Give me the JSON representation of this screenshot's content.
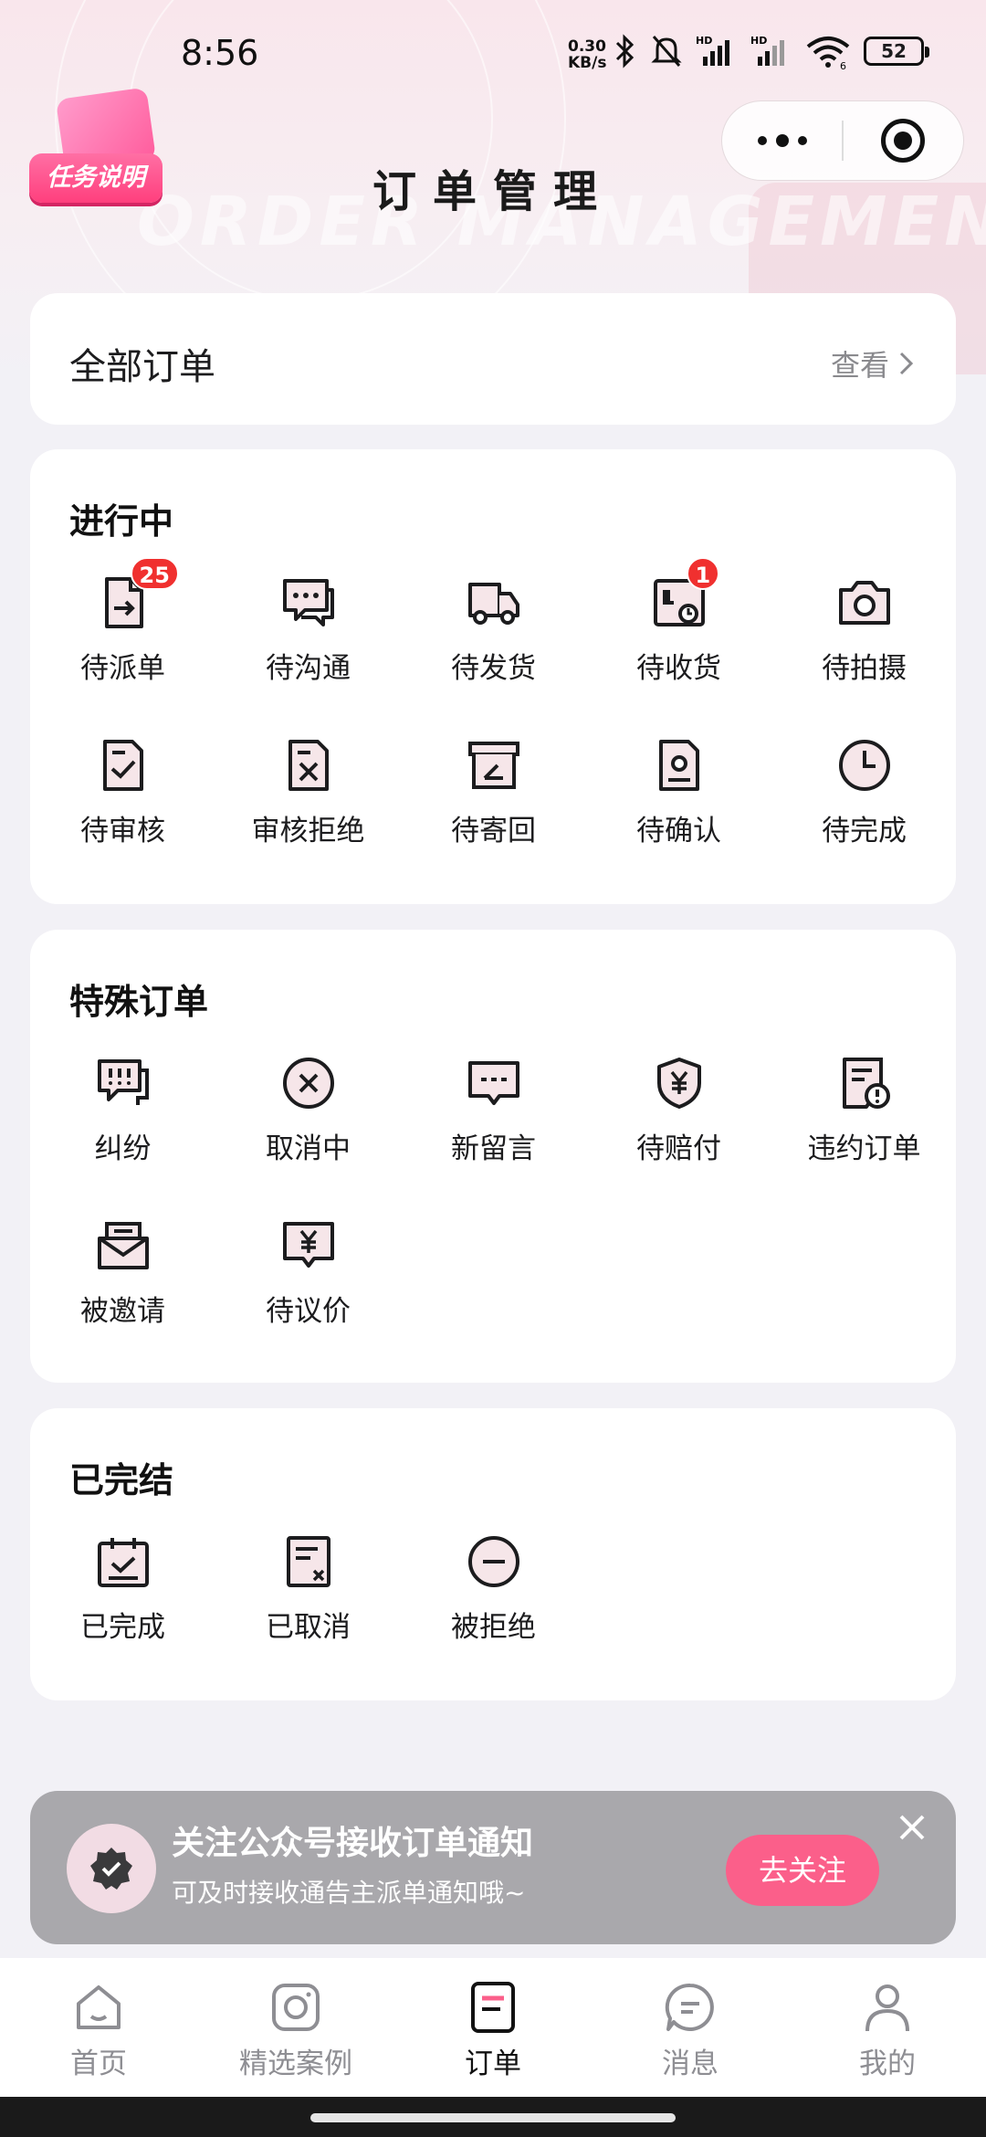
{
  "status_bar": {
    "time": "8:56",
    "net_speed_top": "0.30",
    "net_speed_bottom": "KB/s",
    "battery": "52",
    "signal_1": "HD",
    "signal_2": "HD",
    "wifi_badge": "6"
  },
  "header": {
    "task_badge_label": "任务说明",
    "title": "订单管理",
    "watermark": "ORDER MANAGEMENT"
  },
  "all_orders": {
    "title": "全部订单",
    "view_label": "查看"
  },
  "ongoing": {
    "title": "进行中",
    "items": [
      {
        "label": "待派单",
        "badge": "25"
      },
      {
        "label": "待沟通"
      },
      {
        "label": "待发货"
      },
      {
        "label": "待收货",
        "badge": "1"
      },
      {
        "label": "待拍摄"
      },
      {
        "label": "待审核"
      },
      {
        "label": "审核拒绝"
      },
      {
        "label": "待寄回"
      },
      {
        "label": "待确认"
      },
      {
        "label": "待完成"
      }
    ]
  },
  "special": {
    "title": "特殊订单",
    "items": [
      {
        "label": "纠纷"
      },
      {
        "label": "取消中"
      },
      {
        "label": "新留言"
      },
      {
        "label": "待赔付"
      },
      {
        "label": "违约订单"
      },
      {
        "label": "被邀请"
      },
      {
        "label": "待议价"
      }
    ]
  },
  "completed": {
    "title": "已完结",
    "items": [
      {
        "label": "已完成"
      },
      {
        "label": "已取消"
      },
      {
        "label": "被拒绝"
      }
    ]
  },
  "notice": {
    "title": "关注公众号接收订单通知",
    "subtitle": "可及时接收通告主派单通知哦~",
    "button": "去关注"
  },
  "tabbar": [
    {
      "label": "首页",
      "icon": "home-icon"
    },
    {
      "label": "精选案例",
      "icon": "camera-icon"
    },
    {
      "label": "订单",
      "icon": "order-icon",
      "active": true
    },
    {
      "label": "消息",
      "icon": "message-icon"
    },
    {
      "label": "我的",
      "icon": "profile-icon"
    }
  ],
  "colors": {
    "accent": "#fb5f8a",
    "badge": "#f0302f",
    "icon_fill": "#f6e6e9",
    "stroke": "#1c1c1e"
  }
}
